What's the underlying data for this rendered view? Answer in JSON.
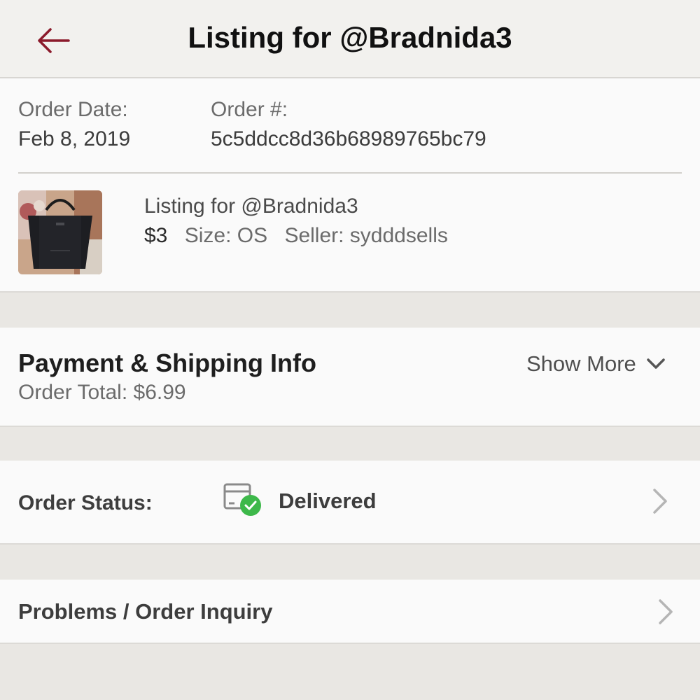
{
  "header": {
    "title": "Listing for @Bradnida3",
    "back_icon": "back-arrow-icon",
    "accent_color": "#8b1a2b"
  },
  "order": {
    "date_label": "Order Date:",
    "date_value": "Feb 8, 2019",
    "number_label": "Order #:",
    "number_value": "5c5ddcc8d36b68989765bc79"
  },
  "listing": {
    "title": "Listing for @Bradnida3",
    "price": "$3",
    "size": "Size: OS",
    "seller": "Seller: sydddsells"
  },
  "payment": {
    "title": "Payment & Shipping Info",
    "order_total": "Order Total: $6.99",
    "show_more_label": "Show More"
  },
  "status": {
    "label": "Order Status:",
    "value": "Delivered",
    "icon": "package-delivered-icon",
    "check_color": "#3db84a"
  },
  "problems": {
    "label": "Problems / Order Inquiry"
  }
}
